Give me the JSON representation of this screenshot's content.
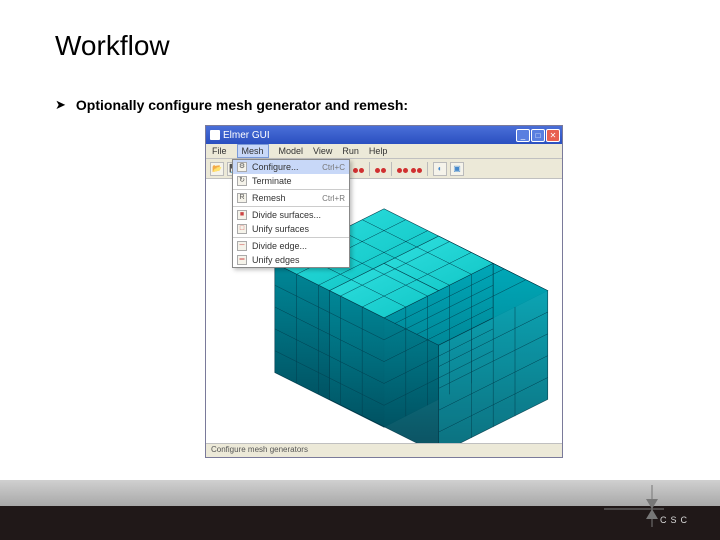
{
  "slide": {
    "title": "Workflow",
    "bullet_marker": "➤",
    "bullet_text": "Optionally configure mesh generator and remesh:"
  },
  "app": {
    "title": "Elmer GUI",
    "menus": [
      "File",
      "Mesh",
      "Model",
      "View",
      "Run",
      "Help"
    ],
    "active_menu_index": 1,
    "dropdown": {
      "items": [
        {
          "icon": "⚙",
          "label": "Configure...",
          "shortcut": "Ctrl+C",
          "hl": true
        },
        {
          "icon": "↻",
          "label": "Terminate"
        },
        {
          "sep": true
        },
        {
          "icon": "R",
          "label": "Remesh",
          "shortcut": "Ctrl+R"
        },
        {
          "sep": true
        },
        {
          "icon": "■",
          "label": "Divide surfaces..."
        },
        {
          "icon": "□",
          "label": "Unify surfaces"
        },
        {
          "sep": true
        },
        {
          "icon": "─",
          "label": "Divide edge..."
        },
        {
          "icon": "═",
          "label": "Unify edges"
        }
      ]
    },
    "status": "Configure mesh generators"
  },
  "footer": {
    "logo_letters": [
      "C",
      "S",
      "C"
    ]
  }
}
